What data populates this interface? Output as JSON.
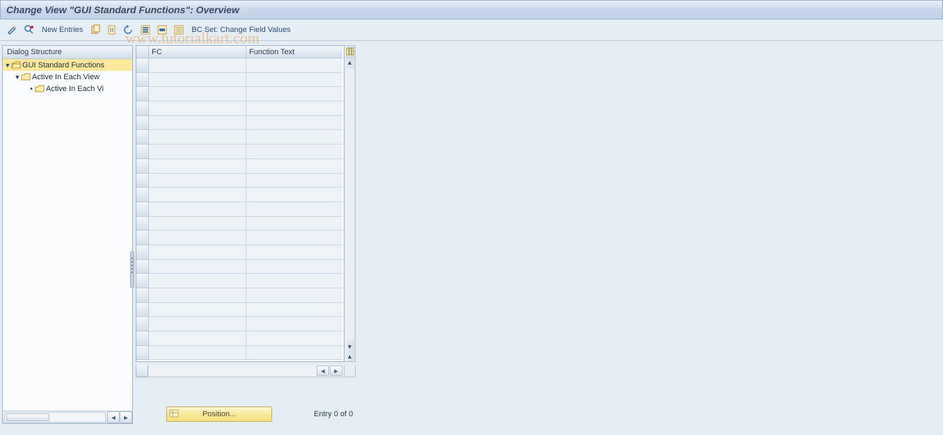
{
  "title": "Change View \"GUI Standard Functions\": Overview",
  "toolbar": {
    "new_entries": "New Entries",
    "bc_set": "BC Set: Change Field Values"
  },
  "tree": {
    "header": "Dialog Structure",
    "node1": "GUI Standard Functions",
    "node2": "Active In Each View",
    "node3": "Active In Each Vi"
  },
  "grid": {
    "col_fc": "FC",
    "col_functext": "Function Text"
  },
  "footer": {
    "position_btn": "Position...",
    "entry_status": "Entry 0 of 0"
  },
  "watermark": "www.tutorialkart.com"
}
